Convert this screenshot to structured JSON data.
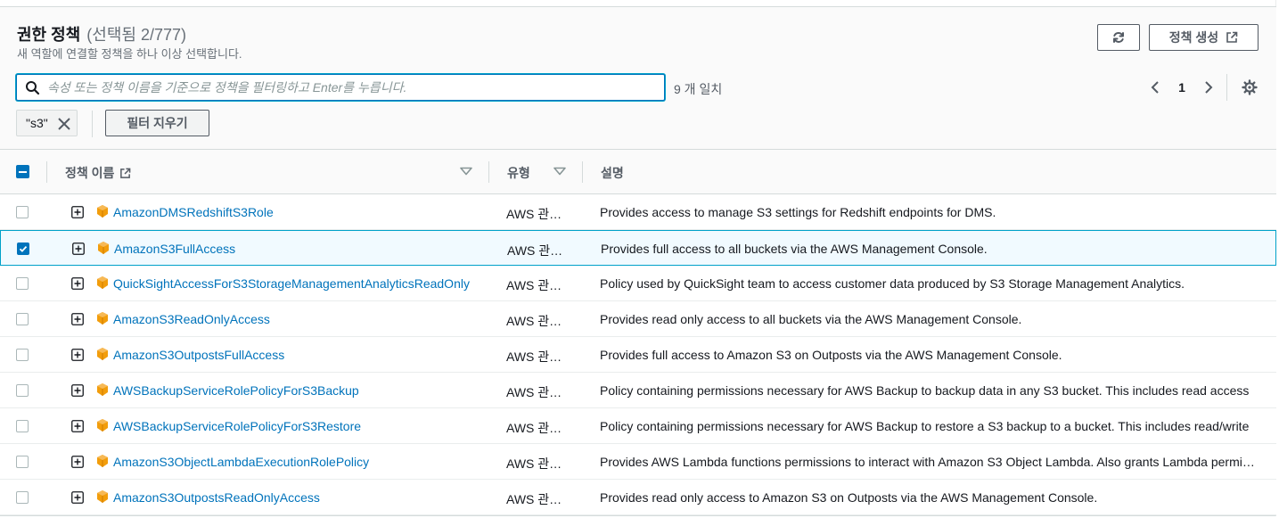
{
  "header": {
    "title": "권한 정책",
    "selection_count": "(선택됨 2/777)",
    "subtitle": "새 역할에 연결할 정책을 하나 이상 선택합니다.",
    "create_policy_label": "정책 생성"
  },
  "search": {
    "placeholder": "속성 또는 정책 이름을 기준으로 정책을 필터링하고 Enter를 누릅니다.",
    "value": "",
    "match_count": "9 개 일치"
  },
  "pagination": {
    "current_page": "1"
  },
  "filters": {
    "token_label": "\"s3\"",
    "clear_label": "필터 지우기"
  },
  "table": {
    "columns": {
      "name": "정책 이름",
      "type": "유형",
      "description": "설명"
    },
    "rows": [
      {
        "name": "AmazonDMSRedshiftS3Role",
        "type": "AWS 관리형",
        "description": "Provides access to manage S3 settings for Redshift endpoints for DMS.",
        "checked": false
      },
      {
        "name": "AmazonS3FullAccess",
        "type": "AWS 관리형",
        "description": "Provides full access to all buckets via the AWS Management Console.",
        "checked": true
      },
      {
        "name": "QuickSightAccessForS3StorageManagementAnalyticsReadOnly",
        "type": "AWS 관리형",
        "description": "Policy used by QuickSight team to access customer data produced by S3 Storage Management Analytics.",
        "checked": false
      },
      {
        "name": "AmazonS3ReadOnlyAccess",
        "type": "AWS 관리형",
        "description": "Provides read only access to all buckets via the AWS Management Console.",
        "checked": false
      },
      {
        "name": "AmazonS3OutpostsFullAccess",
        "type": "AWS 관리형",
        "description": "Provides full access to Amazon S3 on Outposts via the AWS Management Console.",
        "checked": false
      },
      {
        "name": "AWSBackupServiceRolePolicyForS3Backup",
        "type": "AWS 관리형",
        "description": "Policy containing permissions necessary for AWS Backup to backup data in any S3 bucket. This includes read access",
        "checked": false
      },
      {
        "name": "AWSBackupServiceRolePolicyForS3Restore",
        "type": "AWS 관리형",
        "description": "Policy containing permissions necessary for AWS Backup to restore a S3 backup to a bucket. This includes read/write",
        "checked": false
      },
      {
        "name": "AmazonS3ObjectLambdaExecutionRolePolicy",
        "type": "AWS 관리형",
        "description": "Provides AWS Lambda functions permissions to interact with Amazon S3 Object Lambda. Also grants Lambda permissions",
        "checked": false
      },
      {
        "name": "AmazonS3OutpostsReadOnlyAccess",
        "type": "AWS 관리형",
        "description": "Provides read only access to Amazon S3 on Outposts via the AWS Management Console.",
        "checked": false
      }
    ]
  },
  "icons": {
    "search": "search-icon",
    "refresh": "refresh-icon",
    "external": "external-link-icon",
    "prev": "chevron-left-icon",
    "next": "chevron-right-icon",
    "settings": "gear-icon",
    "dismiss": "close-icon",
    "expand": "plus-square-icon",
    "policy": "policy-cube-icon",
    "sort": "caret-down-icon"
  },
  "colors": {
    "accent": "#0073bb",
    "link": "#0073bb",
    "selected_row_bg": "#f1faff",
    "selected_row_border": "#00a1c9",
    "policy_icon": "#f29d0c"
  }
}
